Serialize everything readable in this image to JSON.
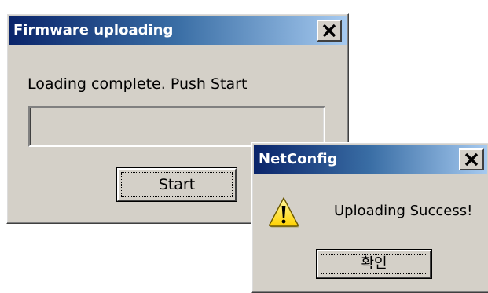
{
  "firmware_dialog": {
    "title": "Firmware uploading",
    "message": "Loading complete. Push Start",
    "progress": 0,
    "start_label": "Start"
  },
  "netconfig_dialog": {
    "title": "NetConfig",
    "message": "Uploading Success!",
    "ok_label": "확인"
  },
  "icons": {
    "close": "close-icon",
    "warning": "warning-icon"
  },
  "colors": {
    "titlebar_start": "#0a246a",
    "titlebar_end": "#a6caf0",
    "window_face": "#d4d0c8",
    "warning_yellow": "#ffde00"
  }
}
